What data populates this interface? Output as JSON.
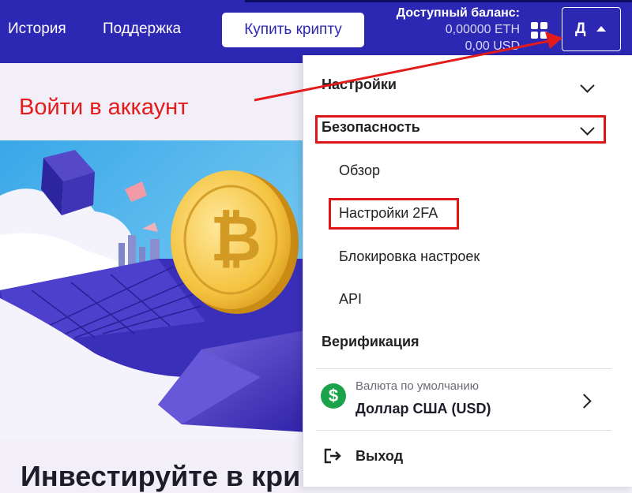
{
  "header": {
    "nav": [
      "История",
      "Поддержка"
    ],
    "buy_button": "Купить крипту",
    "balance_title": "Доступный баланс:",
    "balance_eth": "0,00000 ETH",
    "balance_usd": "0,00 USD",
    "user_initial": "Д",
    "brand_color": "#2d28b4"
  },
  "annotation": {
    "login_text": "Войти в аккаунт",
    "highlight_color": "#e41b1b"
  },
  "main": {
    "heading": "Инвестируйте в кри"
  },
  "menu": {
    "settings": "Настройки",
    "security": "Безопасность",
    "security_items": [
      "Обзор",
      "Настройки 2FA",
      "Блокировка настроек",
      "API"
    ],
    "verification": "Верификация",
    "currency_label": "Валюта по умолчанию",
    "currency_value": "Доллар США (USD)",
    "currency_symbol": "$",
    "logout": "Выход"
  }
}
